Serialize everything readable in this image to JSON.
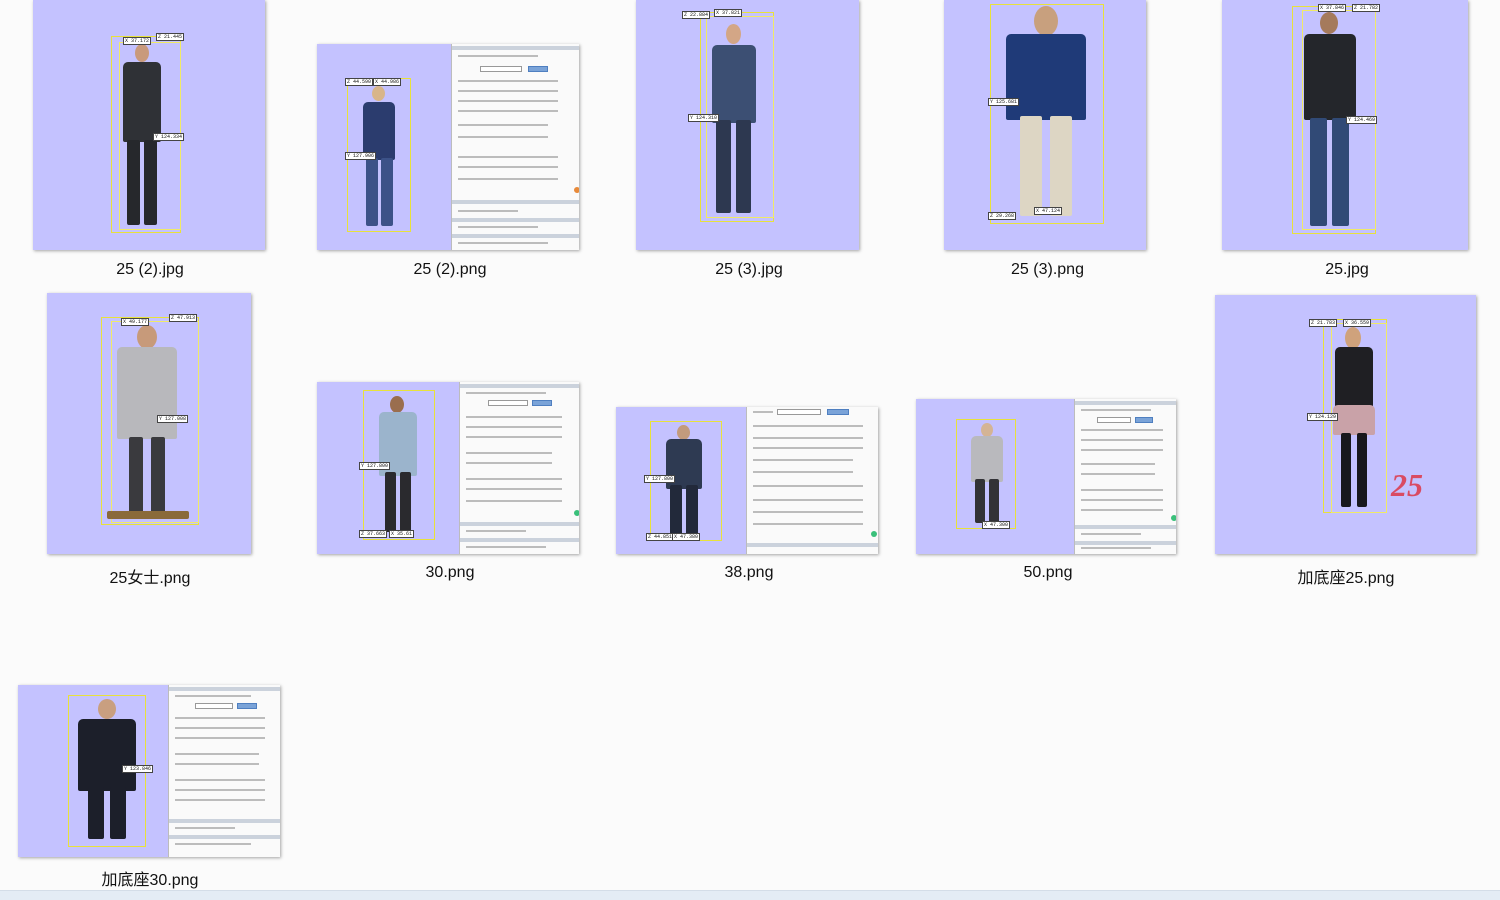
{
  "files": [
    {
      "name": "25 (2).jpg",
      "tags": [
        "X 37.172",
        "Z 21.445",
        "Y 124.334"
      ]
    },
    {
      "name": "25 (2).png",
      "tags": [
        "Z 44.590",
        "X 44.986",
        "Y 127.906"
      ]
    },
    {
      "name": "25 (3).jpg",
      "tags": [
        "Z 22.884",
        "X 37.821",
        "Y 124.310"
      ]
    },
    {
      "name": "25 (3).png",
      "tags": [
        "Y 125.681",
        "Z 29.268",
        "X 47.124"
      ]
    },
    {
      "name": "25.jpg",
      "tags": [
        "X 37.846",
        "Z 21.782",
        "Y 124.469"
      ]
    },
    {
      "name": "25女士.png",
      "tags": [
        "X 49.177",
        "Z 47.913",
        "Y 127.008"
      ]
    },
    {
      "name": "30.png",
      "tags": [
        "Y 127.800",
        "Z 37.663",
        "X 35.61"
      ]
    },
    {
      "name": "38.png",
      "tags": [
        "Y 127.800",
        "Z 44.851",
        "X 47.380"
      ]
    },
    {
      "name": "50.png",
      "tags": [
        "X 47.300"
      ]
    },
    {
      "name": "加底座25.png",
      "tags": [
        "Z 21.783",
        "X 36.559",
        "Y 124.129"
      ],
      "handwritten": "25"
    },
    {
      "name": "加底座30.png",
      "tags": [
        "Y 123.846"
      ]
    }
  ],
  "colors": {
    "thumb_bg": "#c4c2ff",
    "bbox": "#e8e23a",
    "handwritten": "#d94b62",
    "page_bg": "#fbfbfb"
  }
}
